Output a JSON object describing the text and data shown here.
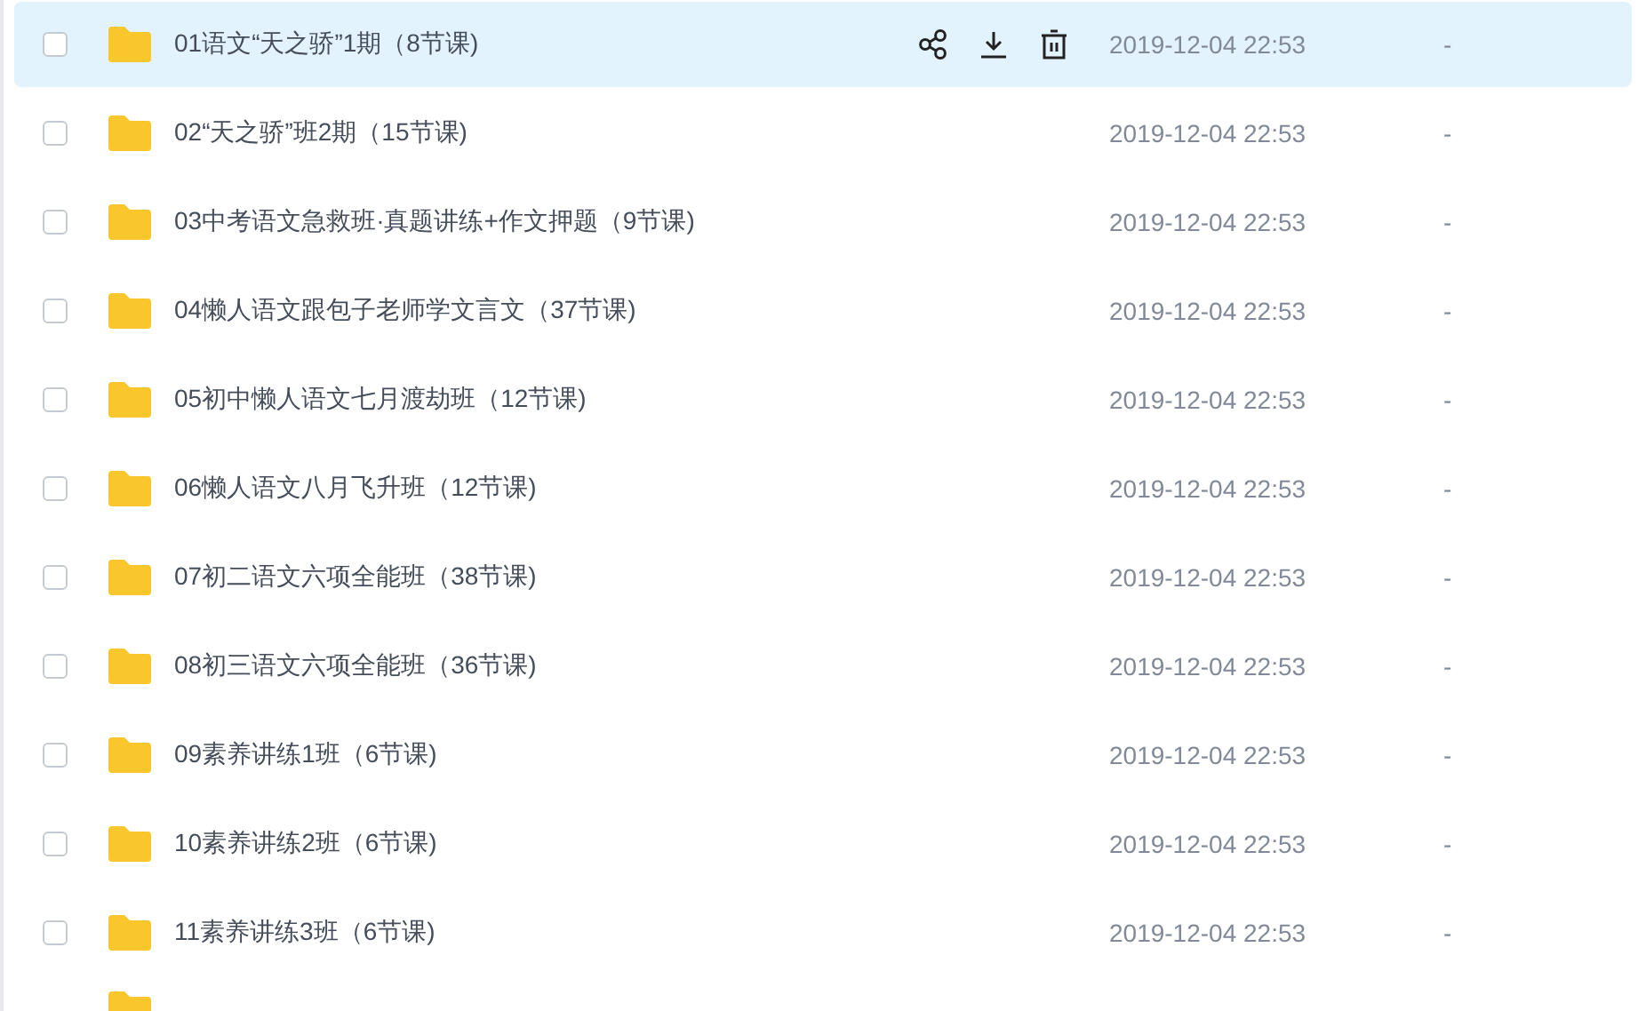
{
  "files": [
    {
      "name": "01语文“天之骄”1期（8节课)",
      "modified": "2019-12-04 22:53",
      "size": "-",
      "checked": false,
      "hovered": true
    },
    {
      "name": "02“天之骄”班2期（15节课)",
      "modified": "2019-12-04 22:53",
      "size": "-",
      "checked": false,
      "hovered": false
    },
    {
      "name": "03中考语文急救班·真题讲练+作文押题（9节课)",
      "modified": "2019-12-04 22:53",
      "size": "-",
      "checked": false,
      "hovered": false
    },
    {
      "name": "04懒人语文跟包子老师学文言文（37节课)",
      "modified": "2019-12-04 22:53",
      "size": "-",
      "checked": false,
      "hovered": false
    },
    {
      "name": "05初中懒人语文七月渡劫班（12节课)",
      "modified": "2019-12-04 22:53",
      "size": "-",
      "checked": false,
      "hovered": false
    },
    {
      "name": "06懒人语文八月飞升班（12节课)",
      "modified": "2019-12-04 22:53",
      "size": "-",
      "checked": false,
      "hovered": false
    },
    {
      "name": "07初二语文六项全能班（38节课)",
      "modified": "2019-12-04 22:53",
      "size": "-",
      "checked": false,
      "hovered": false
    },
    {
      "name": "08初三语文六项全能班（36节课)",
      "modified": "2019-12-04 22:53",
      "size": "-",
      "checked": false,
      "hovered": false
    },
    {
      "name": "09素养讲练1班（6节课)",
      "modified": "2019-12-04 22:53",
      "size": "-",
      "checked": false,
      "hovered": false
    },
    {
      "name": "10素养讲练2班（6节课)",
      "modified": "2019-12-04 22:53",
      "size": "-",
      "checked": false,
      "hovered": false
    },
    {
      "name": "11素养讲练3班（6节课)",
      "modified": "2019-12-04 22:53",
      "size": "-",
      "checked": false,
      "hovered": false
    }
  ]
}
